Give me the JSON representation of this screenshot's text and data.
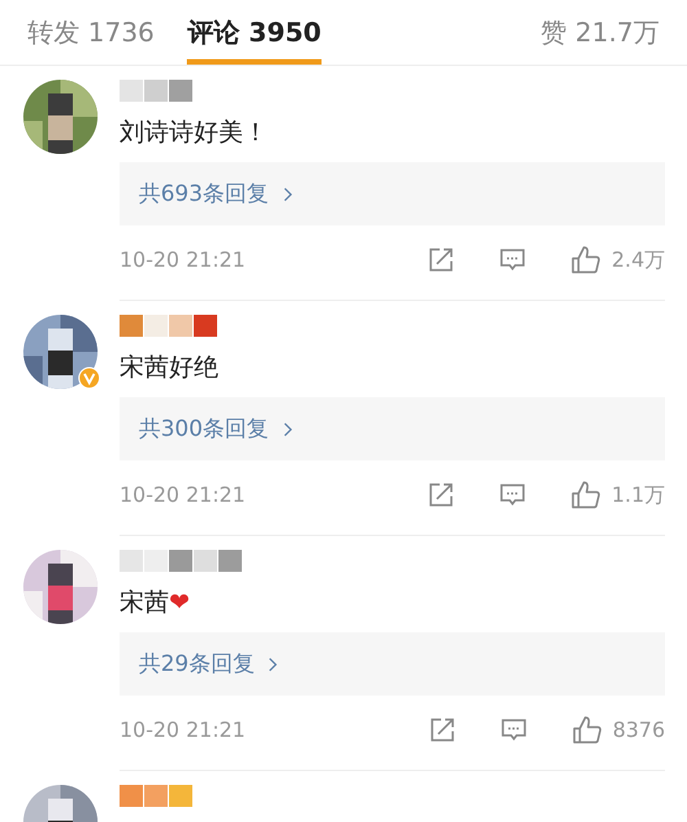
{
  "tabs": [
    {
      "label": "转发 1736",
      "selected": false
    },
    {
      "label": "评论 3950",
      "selected": true
    }
  ],
  "likes_tab": {
    "label": "赞 21.7万"
  },
  "comments": [
    {
      "kind": "full",
      "verified": false,
      "text": "刘诗诗好美！",
      "replies": "共693条回复",
      "time": "10-20 21:21",
      "likes": "2.4万"
    },
    {
      "kind": "full",
      "verified": true,
      "text": "宋茜好绝",
      "replies": "共300条回复",
      "time": "10-20 21:21",
      "likes": "1.1万"
    },
    {
      "kind": "full",
      "verified": false,
      "text": "宋茜",
      "emoji": "❤",
      "replies": "共29条回复",
      "time": "10-20 21:21",
      "likes": "8376"
    },
    {
      "kind": "cut_off"
    }
  ]
}
